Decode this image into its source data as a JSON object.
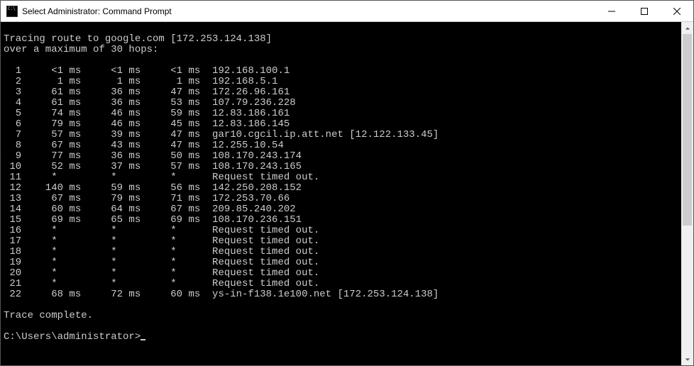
{
  "window": {
    "title": "Select Administrator: Command Prompt"
  },
  "terminal": {
    "blank_top": "",
    "trace_header1": "Tracing route to google.com [172.253.124.138]",
    "trace_header2": "over a maximum of 30 hops:",
    "hops": [
      {
        "n": "1",
        "t1": "<1 ms",
        "t2": "<1 ms",
        "t3": "<1 ms",
        "host": "192.168.100.1"
      },
      {
        "n": "2",
        "t1": "1 ms",
        "t2": "1 ms",
        "t3": "1 ms",
        "host": "192.168.5.1"
      },
      {
        "n": "3",
        "t1": "61 ms",
        "t2": "36 ms",
        "t3": "47 ms",
        "host": "172.26.96.161"
      },
      {
        "n": "4",
        "t1": "61 ms",
        "t2": "36 ms",
        "t3": "53 ms",
        "host": "107.79.236.228"
      },
      {
        "n": "5",
        "t1": "74 ms",
        "t2": "46 ms",
        "t3": "59 ms",
        "host": "12.83.186.161"
      },
      {
        "n": "6",
        "t1": "79 ms",
        "t2": "46 ms",
        "t3": "45 ms",
        "host": "12.83.186.145"
      },
      {
        "n": "7",
        "t1": "57 ms",
        "t2": "39 ms",
        "t3": "47 ms",
        "host": "gar10.cgcil.ip.att.net [12.122.133.45]"
      },
      {
        "n": "8",
        "t1": "67 ms",
        "t2": "43 ms",
        "t3": "47 ms",
        "host": "12.255.10.54"
      },
      {
        "n": "9",
        "t1": "77 ms",
        "t2": "36 ms",
        "t3": "50 ms",
        "host": "108.170.243.174"
      },
      {
        "n": "10",
        "t1": "52 ms",
        "t2": "37 ms",
        "t3": "57 ms",
        "host": "108.170.243.165"
      },
      {
        "n": "11",
        "t1": "*",
        "t2": "*",
        "t3": "*",
        "host": "Request timed out."
      },
      {
        "n": "12",
        "t1": "140 ms",
        "t2": "59 ms",
        "t3": "56 ms",
        "host": "142.250.208.152"
      },
      {
        "n": "13",
        "t1": "67 ms",
        "t2": "79 ms",
        "t3": "71 ms",
        "host": "172.253.70.66"
      },
      {
        "n": "14",
        "t1": "60 ms",
        "t2": "64 ms",
        "t3": "67 ms",
        "host": "209.85.240.202"
      },
      {
        "n": "15",
        "t1": "69 ms",
        "t2": "65 ms",
        "t3": "69 ms",
        "host": "108.170.236.151"
      },
      {
        "n": "16",
        "t1": "*",
        "t2": "*",
        "t3": "*",
        "host": "Request timed out."
      },
      {
        "n": "17",
        "t1": "*",
        "t2": "*",
        "t3": "*",
        "host": "Request timed out."
      },
      {
        "n": "18",
        "t1": "*",
        "t2": "*",
        "t3": "*",
        "host": "Request timed out."
      },
      {
        "n": "19",
        "t1": "*",
        "t2": "*",
        "t3": "*",
        "host": "Request timed out."
      },
      {
        "n": "20",
        "t1": "*",
        "t2": "*",
        "t3": "*",
        "host": "Request timed out."
      },
      {
        "n": "21",
        "t1": "*",
        "t2": "*",
        "t3": "*",
        "host": "Request timed out."
      },
      {
        "n": "22",
        "t1": "68 ms",
        "t2": "72 ms",
        "t3": "60 ms",
        "host": "ys-in-f138.1e100.net [172.253.124.138]"
      }
    ],
    "trace_complete": "Trace complete.",
    "prompt": "C:\\Users\\administrator>"
  }
}
